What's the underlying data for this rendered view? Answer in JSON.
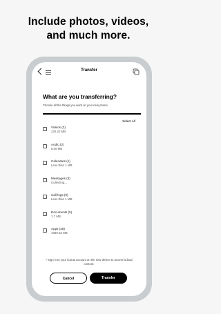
{
  "headline": {
    "line1": "Include photos, videos,",
    "line2": "and much more."
  },
  "nav": {
    "title": "Transfer",
    "back_icon": "chevron-left-icon",
    "menu_icon": "menu-icon",
    "right_icon": "copy-icon"
  },
  "content": {
    "heading": "What are you transferring?",
    "subheading": "Choose all the things you want on your new phone.",
    "progress_fraction": 1.0,
    "select_all": "Select All"
  },
  "items": [
    {
      "name": "Videos (3)",
      "size": "232.22 MB"
    },
    {
      "name": "Audio (2)",
      "size": "8.06 MB"
    },
    {
      "name": "Calendars (1)",
      "size": "Less than 1 MB"
    },
    {
      "name": "Messages (3)",
      "size": "Collecting..."
    },
    {
      "name": "Call logs (9)",
      "size": "Less than 1 MB"
    },
    {
      "name": "Documents (5)",
      "size": "1.7 MB"
    },
    {
      "name": "Apps (35)",
      "size": "1080.53 MB"
    }
  ],
  "footer": {
    "note": "* Sign in to your iCloud account on the new device to access iCloud content.",
    "cancel_label": "Cancel",
    "transfer_label": "Transfer"
  },
  "colors": {
    "background": "#f6f6f6",
    "phone_frame": "#c9cdd0",
    "primary_button": "#000000"
  }
}
